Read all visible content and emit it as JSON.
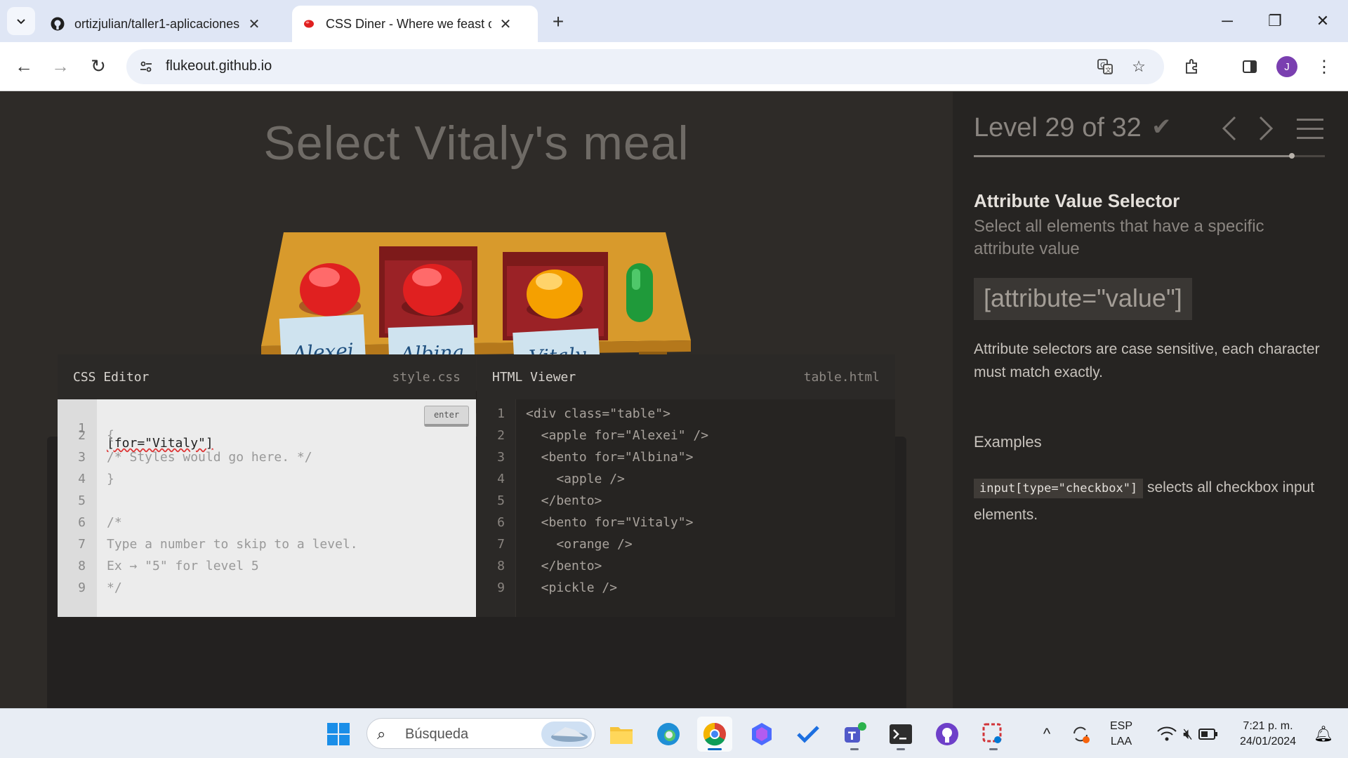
{
  "browser": {
    "tabs": [
      {
        "title": "ortizjulian/taller1-aplicaciones",
        "active": false
      },
      {
        "title": "CSS Diner - Where we feast on CSS",
        "active": true
      }
    ],
    "url": "flukeout.github.io",
    "profile_initial": "J"
  },
  "game": {
    "order_text": "Select Vitaly's meal",
    "plates": [
      {
        "label": "Alexei",
        "item": "apple"
      },
      {
        "label": "Albina",
        "item": "bento with apple"
      },
      {
        "label": "Vitaly",
        "item": "bento with orange"
      },
      {
        "label": "",
        "item": "pickle"
      }
    ],
    "enter_label": "enter",
    "css_editor": {
      "title": "CSS Editor",
      "file": "style.css",
      "lines": [
        {
          "n": "1",
          "text": "[for=\"Vitaly\"]"
        },
        {
          "n": "2",
          "text": "{"
        },
        {
          "n": "3",
          "text": "/* Styles would go here. */"
        },
        {
          "n": "4",
          "text": "}"
        },
        {
          "n": "5",
          "text": ""
        },
        {
          "n": "6",
          "text": "/*"
        },
        {
          "n": "7",
          "text": "Type a number to skip to a level."
        },
        {
          "n": "8",
          "text": "Ex → \"5\" for level 5"
        },
        {
          "n": "9",
          "text": "*/"
        }
      ]
    },
    "html_viewer": {
      "title": "HTML Viewer",
      "file": "table.html",
      "lines": [
        {
          "n": "1",
          "text": "<div class=\"table\">"
        },
        {
          "n": "2",
          "text": "  <apple for=\"Alexei\" />"
        },
        {
          "n": "3",
          "text": "  <bento for=\"Albina\">"
        },
        {
          "n": "4",
          "text": "    <apple />"
        },
        {
          "n": "5",
          "text": "  </bento>"
        },
        {
          "n": "6",
          "text": "  <bento for=\"Vitaly\">"
        },
        {
          "n": "7",
          "text": "    <orange />"
        },
        {
          "n": "8",
          "text": "  </bento>"
        },
        {
          "n": "9",
          "text": "  <pickle />"
        }
      ]
    }
  },
  "sidebar": {
    "level_text": "Level 29 of 32",
    "progress": 0.906,
    "selector_name": "Attribute Value Selector",
    "selector_title": "Select all elements that have a specific attribute value",
    "syntax": "[attribute=\"value\"]",
    "hint": "Attribute selectors are case sensitive, each character must match exactly.",
    "examples_heading": "Examples",
    "example_code": "input[type=\"checkbox\"]",
    "example_text": " selects all checkbox input elements."
  },
  "taskbar": {
    "search_placeholder": "Búsqueda",
    "lang": "ESP",
    "lang2": "LAA",
    "time": "7:21 p. m.",
    "date": "24/01/2024"
  },
  "colors": {
    "game_bg": "#2e2b28",
    "sidebar_bg": "#262422",
    "table_wood": "#d89a2c",
    "apple_red": "#e02020",
    "orange": "#f5a000",
    "pickle_green": "#1f9a3a",
    "bento": "#9b2226"
  }
}
